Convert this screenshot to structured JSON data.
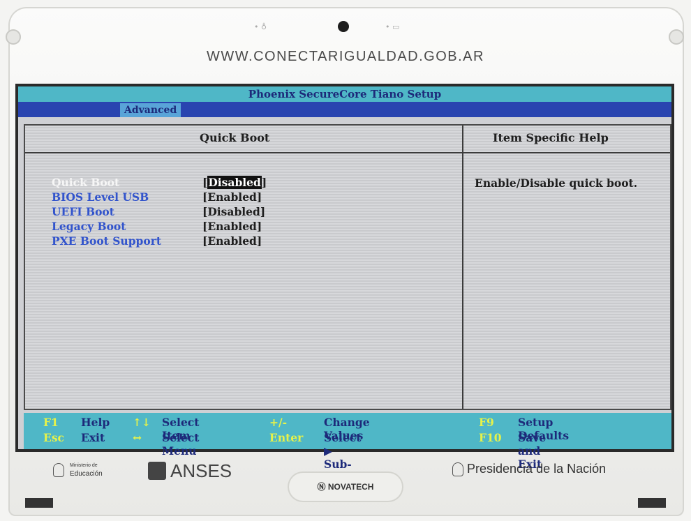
{
  "bezel": {
    "url": "WWW.CONECTARIGUALDAD.GOB.AR",
    "brand_center": "NOVATECH",
    "logos": {
      "educacion_top": "Ministerio de",
      "educacion_bottom": "Educación",
      "anses": "ANSES",
      "presidencia": "Presidencia de la Nación"
    }
  },
  "bios": {
    "title": "Phoenix SecureCore Tiano Setup",
    "active_tab": "Advanced",
    "panel_header": "Quick Boot",
    "help_header": "Item Specific Help",
    "help_text": "Enable/Disable quick boot.",
    "items": [
      {
        "label": "Quick Boot",
        "value": "Disabled",
        "selected": true
      },
      {
        "label": "BIOS Level USB",
        "value": "Enabled",
        "selected": false
      },
      {
        "label": "UEFI Boot",
        "value": "Disabled",
        "selected": false
      },
      {
        "label": "Legacy Boot",
        "value": "Enabled",
        "selected": false
      },
      {
        "label": "PXE Boot Support",
        "value": "Enabled",
        "selected": false
      }
    ],
    "footer": {
      "row1": [
        {
          "key": "F1",
          "desc": "Help"
        },
        {
          "key": "↑↓",
          "desc": "Select Item"
        },
        {
          "key": "+/-",
          "desc": "Change Values"
        },
        {
          "key": "F9",
          "desc": "Setup Defaults"
        }
      ],
      "row2": [
        {
          "key": "Esc",
          "desc": "Exit"
        },
        {
          "key": "↔",
          "desc": "Select Menu"
        },
        {
          "key": "Enter",
          "desc": "Select ▶ Sub-Menu"
        },
        {
          "key": "F10",
          "desc": "Save and Exit"
        }
      ]
    },
    "colors": {
      "title_bar": "#4fb7c7",
      "menu_bar": "#2944b0",
      "item_label": "#3254cc",
      "key_label": "#e6f24a"
    }
  }
}
